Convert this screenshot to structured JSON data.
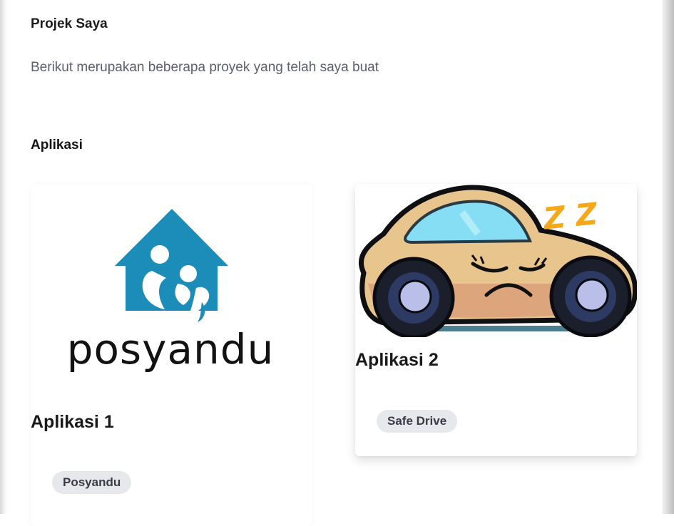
{
  "page": {
    "title": "Projek Saya",
    "subtitle": "Berikut merupakan beberapa proyek yang telah saya buat",
    "section_title": "Aplikasi"
  },
  "cards": [
    {
      "image_text": "posyandu",
      "image_icon": "posyandu-logo",
      "title": "Aplikasi 1",
      "tag": "Posyandu"
    },
    {
      "image_text": "Z Z",
      "image_icon": "sleeping-car-illustration",
      "title": "Aplikasi 2",
      "tag": "Safe Drive"
    }
  ],
  "colors": {
    "logo_blue": "#1c8db8",
    "badge_bg": "#e7e8ec",
    "car_body": "#e9c58e",
    "car_window": "#86def4",
    "zzz": "#f4a81a"
  }
}
